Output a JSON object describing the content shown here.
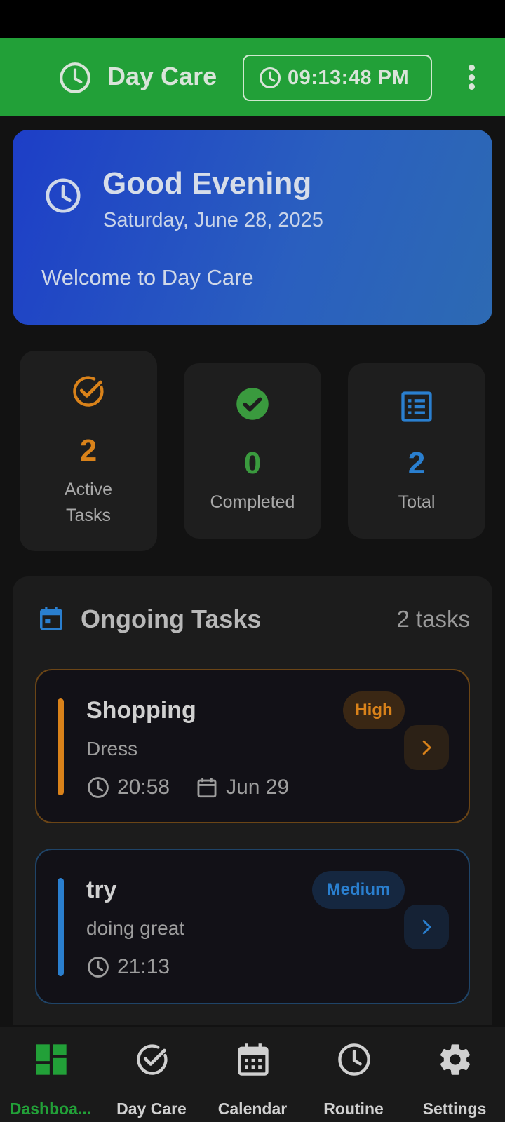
{
  "app_bar": {
    "title": "Day Care",
    "time": "09:13:48 PM",
    "title_icon": "clock-icon",
    "menu_icon": "more-vertical-icon"
  },
  "greeting": {
    "title": "Good Evening",
    "date": "Saturday, June 28, 2025",
    "welcome": "Welcome to Day Care",
    "icon": "clock-icon"
  },
  "stats": [
    {
      "value": "2",
      "label": "Active\nTasks",
      "icon": "check-circle-outline-icon",
      "color": "#d9821a"
    },
    {
      "value": "0",
      "label": "Completed",
      "icon": "check-circle-filled-icon",
      "color": "#3a9a3e"
    },
    {
      "value": "2",
      "label": "Total",
      "icon": "list-icon",
      "color": "#2a7fcf"
    }
  ],
  "ongoing": {
    "title": "Ongoing Tasks",
    "count": "2 tasks",
    "icon": "calendar-icon",
    "tasks": [
      {
        "title": "Shopping",
        "description": "Dress",
        "time": "20:58",
        "date": "Jun 29",
        "priority": "High",
        "accent": "#d9821a",
        "badge_bg": "#3a2714"
      },
      {
        "title": "try",
        "description": "doing great",
        "time": "21:13",
        "priority": "Medium",
        "accent": "#2a7fcf",
        "badge_bg": "#152740"
      }
    ]
  },
  "bottom_nav": {
    "items": [
      {
        "label": "Dashboa...",
        "icon": "dashboard-icon",
        "active": true
      },
      {
        "label": "Day Care",
        "icon": "check-circle-outline-icon"
      },
      {
        "label": "Calendar",
        "icon": "calendar-icon"
      },
      {
        "label": "Routine",
        "icon": "clock-icon"
      },
      {
        "label": "Settings",
        "icon": "gear-icon"
      }
    ],
    "active_color": "#22a038"
  }
}
